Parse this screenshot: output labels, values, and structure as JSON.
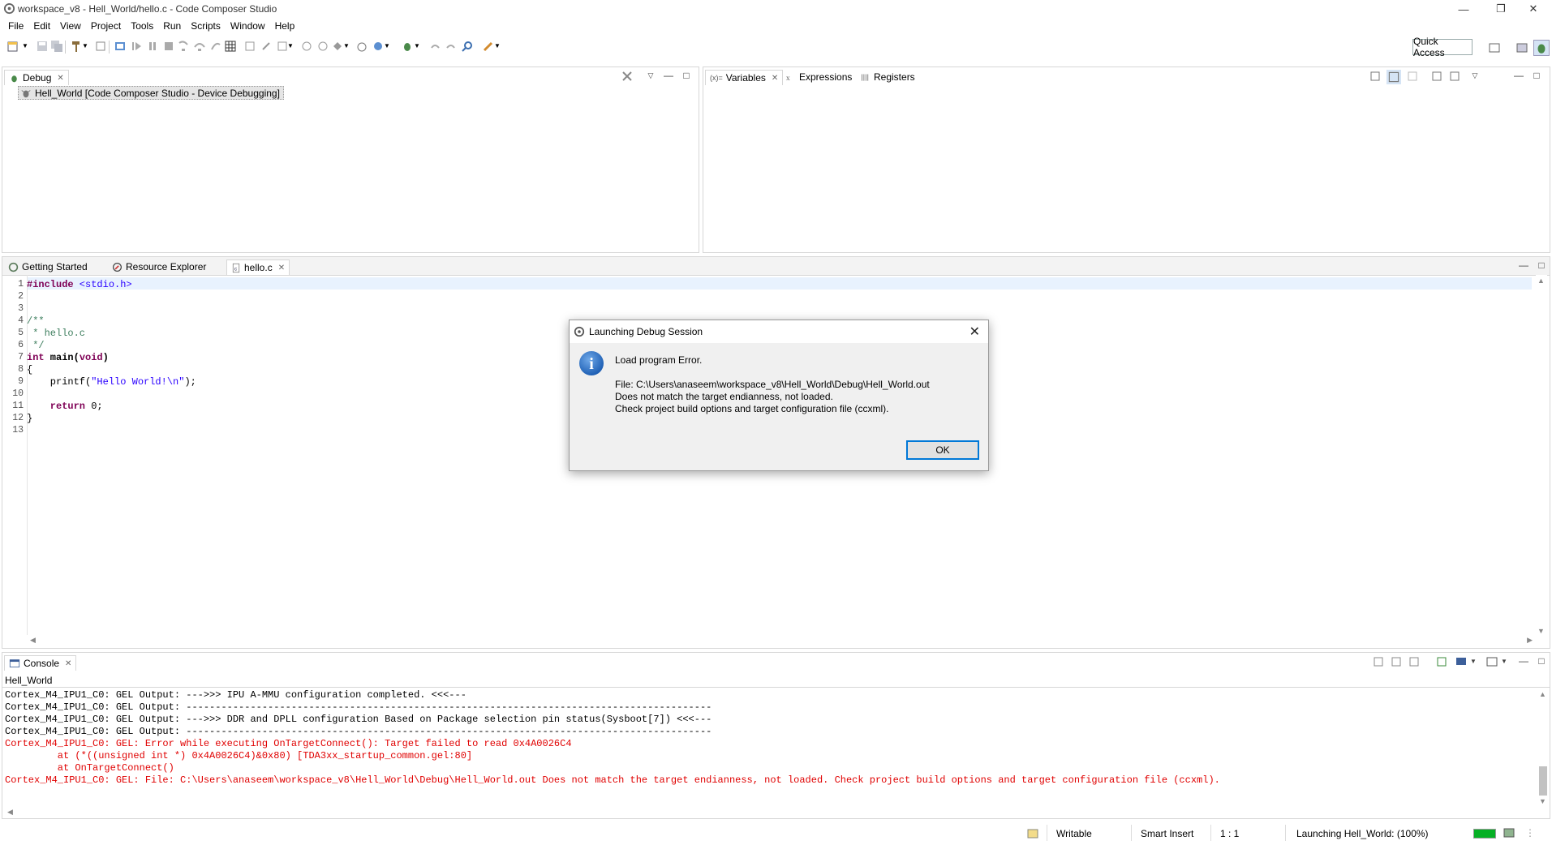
{
  "window": {
    "title": "workspace_v8 - Hell_World/hello.c - Code Composer Studio",
    "min_glyph": "—",
    "restore_glyph": "❐",
    "close_glyph": "✕"
  },
  "menu": [
    "File",
    "Edit",
    "View",
    "Project",
    "Tools",
    "Run",
    "Scripts",
    "Window",
    "Help"
  ],
  "toolbar": {
    "quick_access": "Quick Access"
  },
  "debug_view": {
    "tab_label": "Debug",
    "session_item": "Hell_World [Code Composer Studio - Device Debugging]"
  },
  "variables_view": {
    "tabs": [
      "Variables",
      "Expressions",
      "Registers"
    ],
    "variables_prefix": "(x)="
  },
  "editor": {
    "tabs": [
      "Getting Started",
      "Resource Explorer",
      "hello.c"
    ],
    "line_numbers": [
      "1",
      "2",
      "3",
      "4",
      "5",
      "6",
      "7",
      "8",
      "9",
      "10",
      "11",
      "12",
      "13"
    ],
    "code": {
      "l1_directive": "#include",
      "l1_header": " <stdio.h>",
      "l4": "/**",
      "l5": " * hello.c",
      "l6": " */",
      "l7_kw": "int",
      "l7_rest": " main(",
      "l7_kw2": "void",
      "l7_end": ")",
      "l8": "{",
      "l9_pre": "    printf(",
      "l9_str": "\"Hello World!\\n\"",
      "l9_post": ");",
      "l11_kw": "    return",
      "l11_rest": " 0;",
      "l12": "}"
    }
  },
  "dialog": {
    "title": "Launching Debug Session",
    "close_glyph": "✕",
    "heading": "Load program Error.",
    "line1": "File: C:\\Users\\anaseem\\workspace_v8\\Hell_World\\Debug\\Hell_World.out",
    "line2": "Does not match the target endianness, not loaded.",
    "line3": "Check project build options and target configuration file (ccxml).",
    "ok_label": "OK",
    "info_glyph": "i"
  },
  "console": {
    "tab_label": "Console",
    "process": "Hell_World",
    "lines": [
      {
        "text": "Cortex_M4_IPU1_C0: GEL Output: --->>> IPU A-MMU configuration completed. <<<---",
        "error": false
      },
      {
        "text": "Cortex_M4_IPU1_C0: GEL Output: ------------------------------------------------------------------------------------------",
        "error": false
      },
      {
        "text": "Cortex_M4_IPU1_C0: GEL Output: --->>> DDR and DPLL configuration Based on Package selection pin status(Sysboot[7]) <<<---",
        "error": false
      },
      {
        "text": "Cortex_M4_IPU1_C0: GEL Output: ------------------------------------------------------------------------------------------",
        "error": false
      },
      {
        "text": "Cortex_M4_IPU1_C0: GEL: Error while executing OnTargetConnect(): Target failed to read 0x4A0026C4",
        "error": true
      },
      {
        "text": "\t at (*((unsigned int *) 0x4A0026C4)&0x80) [TDA3xx_startup_common.gel:80]",
        "error": true
      },
      {
        "text": "\t at OnTargetConnect()",
        "error": true
      },
      {
        "text": "Cortex_M4_IPU1_C0: GEL: File: C:\\Users\\anaseem\\workspace_v8\\Hell_World\\Debug\\Hell_World.out Does not match the target endianness, not loaded. Check project build options and target configuration file (ccxml).",
        "error": true
      }
    ]
  },
  "status_bar": {
    "writable": "Writable",
    "insert_mode": "Smart Insert",
    "position": "1 : 1",
    "progress_text": "Launching Hell_World: (100%)",
    "progress_fraction": 1.0
  },
  "colors": {
    "accent": "#0078d7",
    "error_text": "#e00000",
    "info_icon": "#1e5fb4"
  }
}
